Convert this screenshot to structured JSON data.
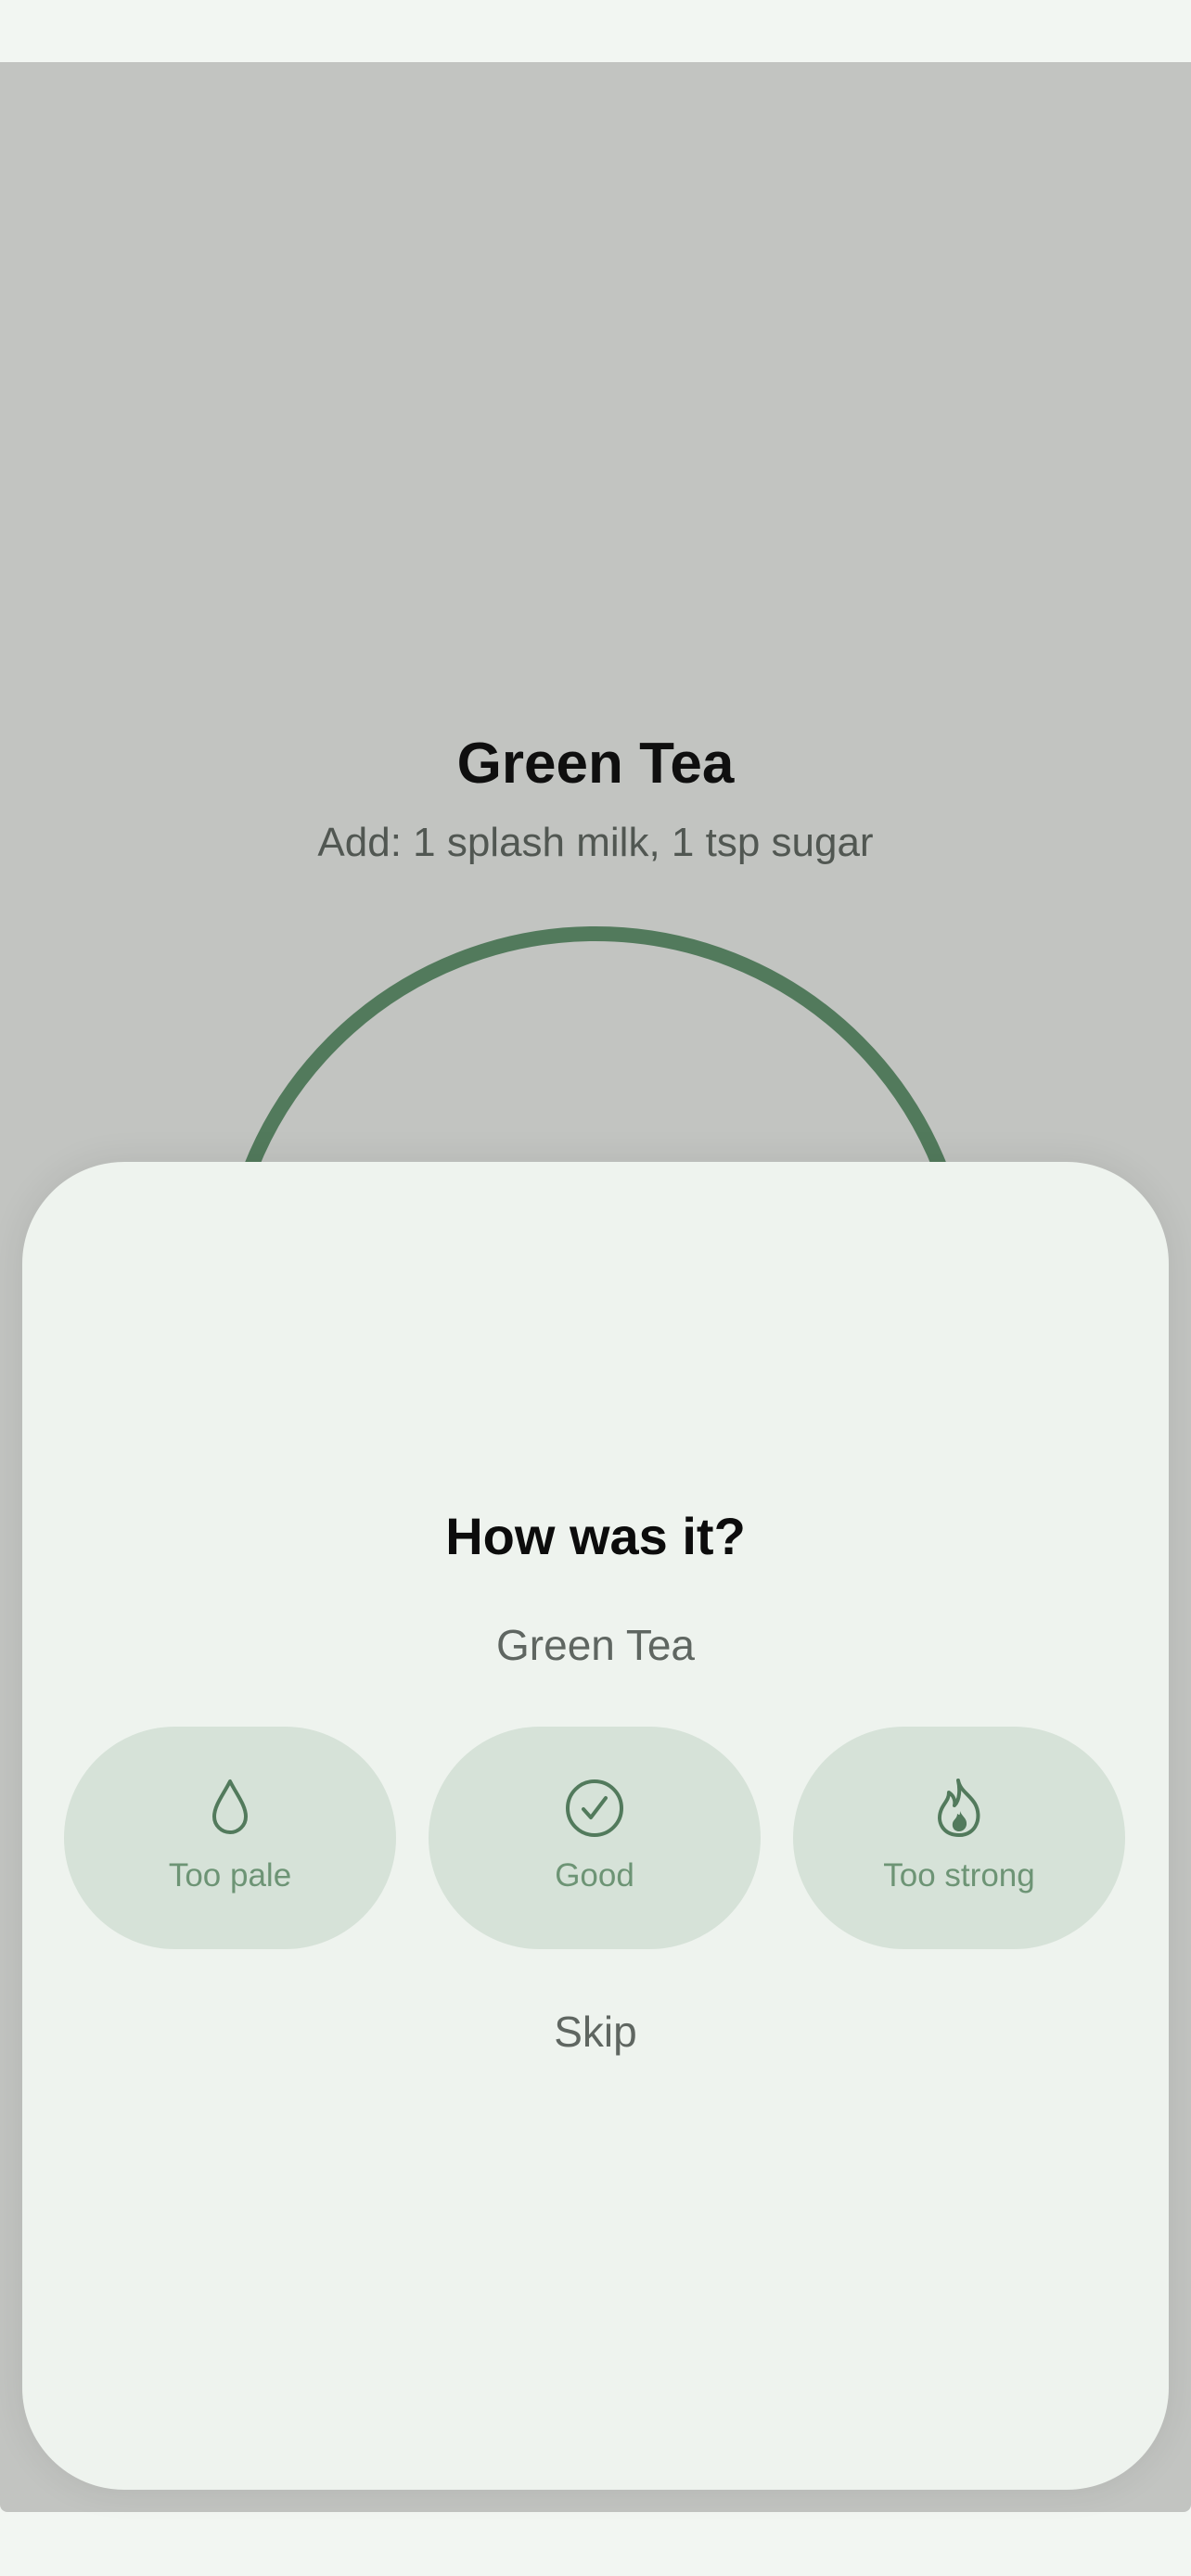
{
  "background": {
    "title": "Green Tea",
    "subtitle": "Add: 1 splash milk, 1 tsp sugar"
  },
  "sheet": {
    "title": "How was it?",
    "subtitle": "Green Tea",
    "options": [
      {
        "label": "Too pale",
        "icon": "droplet-icon"
      },
      {
        "label": "Good",
        "icon": "check-circle-icon"
      },
      {
        "label": "Too strong",
        "icon": "flame-icon"
      }
    ],
    "skip_label": "Skip"
  },
  "colors": {
    "accent": "#527a5c",
    "option_bg": "#d6e2d8",
    "option_text": "#6d9475",
    "sheet_bg": "#eef3ee",
    "scrim": "#c2c4c1"
  }
}
